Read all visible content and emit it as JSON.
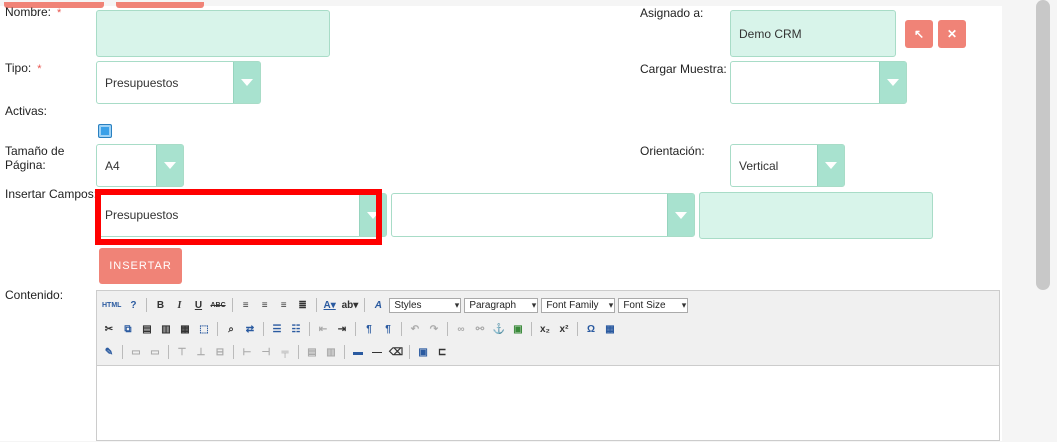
{
  "form": {
    "name_label": "Nombre:",
    "required_mark": "*",
    "name_value": "",
    "assigned_label": "Asignado a:",
    "assigned_value": "Demo CRM",
    "select_user_glyph": "↖",
    "clear_user_glyph": "✕",
    "type_label": "Tipo:",
    "type_value": "Presupuestos",
    "sample_label": "Cargar Muestra:",
    "sample_value": "",
    "active_label": "Activas:",
    "active_checked": true,
    "page_size_label": "Tamaño de Página:",
    "page_size_value": "A4",
    "orientation_label": "Orientación:",
    "orientation_value": "Vertical",
    "insert_fields_label": "Insertar Campos:",
    "insert_module_value": "Presupuestos",
    "insert_field_value": "",
    "insert_variable_value": "",
    "insert_button": "INSERTAR",
    "content_label": "Contenido:"
  },
  "editor": {
    "styles_select": "Styles",
    "paragraph_select": "Paragraph",
    "font_family_select": "Font Family",
    "font_size_select": "Font Size",
    "icons_row1": [
      "html-icon",
      "help-icon",
      "bold-icon",
      "italic-icon",
      "underline-icon",
      "strikethrough-icon",
      "align-left-icon",
      "align-center-icon",
      "align-right-icon",
      "align-justify-icon",
      "font-color-icon",
      "highlight-color-icon",
      "font-style-icon"
    ],
    "icons_row2": [
      "cut-icon",
      "copy-icon",
      "paste-icon",
      "paste-text-icon",
      "paste-word-icon",
      "select-all-icon",
      "find-icon",
      "replace-icon",
      "bullet-list-icon",
      "number-list-icon",
      "outdent-icon",
      "indent-icon",
      "ltr-icon",
      "rtl-icon",
      "undo-icon",
      "redo-icon",
      "link-icon",
      "unlink-icon",
      "anchor-icon",
      "image-icon",
      "subscript-icon",
      "superscript-icon",
      "special-char-icon",
      "table-icon"
    ],
    "icons_row3": [
      "edit-icon",
      "cell-props-icon",
      "row-props-icon",
      "insert-row-before-icon",
      "insert-row-after-icon",
      "delete-row-icon",
      "insert-col-before-icon",
      "insert-col-after-icon",
      "delete-col-icon",
      "split-cell-icon",
      "merge-cell-icon",
      "hr-icon",
      "line-icon",
      "remove-format-icon",
      "media-icon",
      "page-break-icon"
    ]
  },
  "colors": {
    "accent": "#f08377",
    "field_bg": "#d8f4ea",
    "field_border": "#a8dcc7",
    "highlight": "#ff0000"
  }
}
